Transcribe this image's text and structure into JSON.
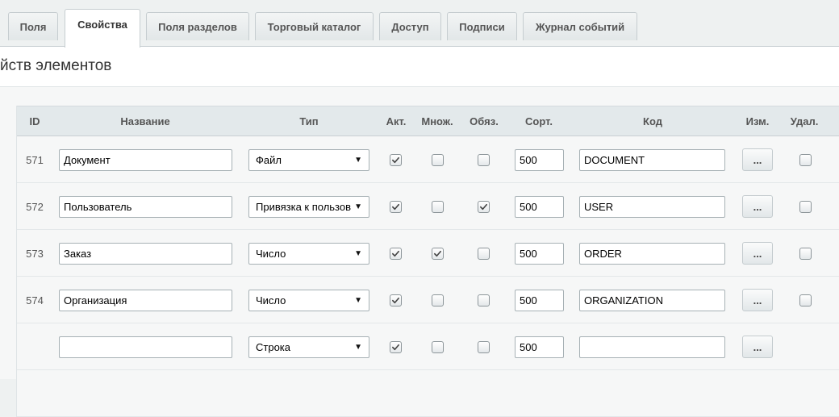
{
  "tabs": [
    {
      "label": "Поля"
    },
    {
      "label": "Свойства"
    },
    {
      "label": "Поля разделов"
    },
    {
      "label": "Торговый каталог"
    },
    {
      "label": "Доступ"
    },
    {
      "label": "Подписи"
    },
    {
      "label": "Журнал событий"
    }
  ],
  "active_tab": "Свойства",
  "section_title": "йств элементов",
  "table": {
    "headers": {
      "id": "ID",
      "name": "Название",
      "type": "Тип",
      "active": "Акт.",
      "multiple": "Множ.",
      "required": "Обяз.",
      "sort": "Сорт.",
      "code": "Код",
      "edit": "Изм.",
      "delete": "Удал."
    },
    "rows": [
      {
        "id": "571",
        "name": "Документ",
        "type": "Файл",
        "active": true,
        "multiple": false,
        "required": false,
        "sort": "500",
        "code": "DOCUMENT",
        "edit": "...",
        "delete": false
      },
      {
        "id": "572",
        "name": "Пользователь",
        "type": "Привязка к пользов",
        "active": true,
        "multiple": false,
        "required": true,
        "sort": "500",
        "code": "USER",
        "edit": "...",
        "delete": false
      },
      {
        "id": "573",
        "name": "Заказ",
        "type": "Число",
        "active": true,
        "multiple": true,
        "required": false,
        "sort": "500",
        "code": "ORDER",
        "edit": "...",
        "delete": false
      },
      {
        "id": "574",
        "name": "Организация",
        "type": "Число",
        "active": true,
        "multiple": false,
        "required": false,
        "sort": "500",
        "code": "ORGANIZATION",
        "edit": "...",
        "delete": false
      },
      {
        "id": "",
        "name": "",
        "type": "Строка",
        "active": true,
        "multiple": false,
        "required": false,
        "sort": "500",
        "code": "",
        "edit": "...",
        "delete": null
      }
    ]
  },
  "icons": {
    "dropdown": "chevron-down-icon",
    "check": "checkmark-icon"
  },
  "colors": {
    "header_bg": "#e3e9eb",
    "row_bg": "#f6f7f7",
    "page_bg": "#eef1f1"
  }
}
